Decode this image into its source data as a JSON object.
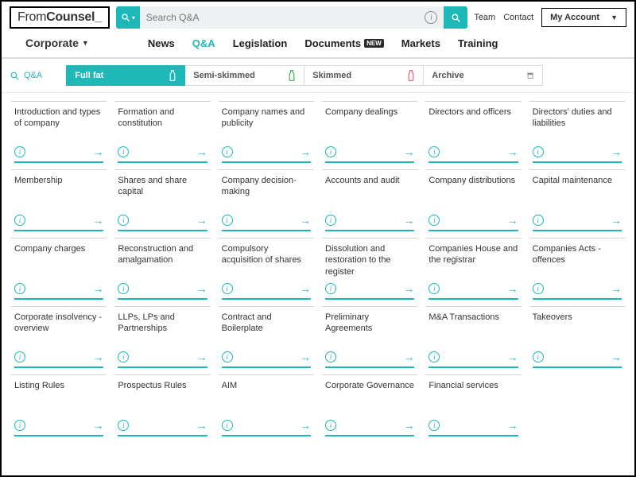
{
  "logo": {
    "part1": "From",
    "part2": "Counsel",
    "cursor": "_"
  },
  "search": {
    "placeholder": "Search Q&A"
  },
  "toplinks": {
    "team": "Team",
    "contact": "Contact",
    "account": "My Account"
  },
  "nav": {
    "primary": "Corporate",
    "items": [
      {
        "label": "News",
        "active": false
      },
      {
        "label": "Q&A",
        "active": true
      },
      {
        "label": "Legislation",
        "active": false
      },
      {
        "label": "Documents",
        "active": false,
        "badge": "NEW"
      },
      {
        "label": "Markets",
        "active": false
      },
      {
        "label": "Training",
        "active": false
      }
    ]
  },
  "breadcrumb": {
    "label": "Q&A"
  },
  "tabs": [
    {
      "label": "Full fat",
      "active": true,
      "iconColor": "#ffffff"
    },
    {
      "label": "Semi-skimmed",
      "active": false,
      "iconColor": "#35a85a"
    },
    {
      "label": "Skimmed",
      "active": false,
      "iconColor": "#e95c7b"
    },
    {
      "label": "Archive",
      "active": false,
      "iconColor": "#888888",
      "archive": true
    }
  ],
  "cards": [
    "Introduction and types of company",
    "Formation and constitution",
    "Company names and publicity",
    "Company dealings",
    "Directors and officers",
    "Directors' duties and liabilities",
    "Membership",
    "Shares and share capital",
    "Company decision-making",
    "Accounts and audit",
    "Company distributions",
    "Capital maintenance",
    "Company charges",
    "Reconstruction and amalgamation",
    "Compulsory acquisition of shares",
    "Dissolution and restoration to the register",
    "Companies House and the registrar",
    "Companies Acts - offences",
    "Corporate insolvency - overview",
    "LLPs, LPs and Partnerships",
    "Contract and Boilerplate",
    "Preliminary Agreements",
    "M&A Transactions",
    "Takeovers",
    "Listing Rules",
    "Prospectus Rules",
    "AIM",
    "Corporate Governance",
    "Financial services"
  ]
}
